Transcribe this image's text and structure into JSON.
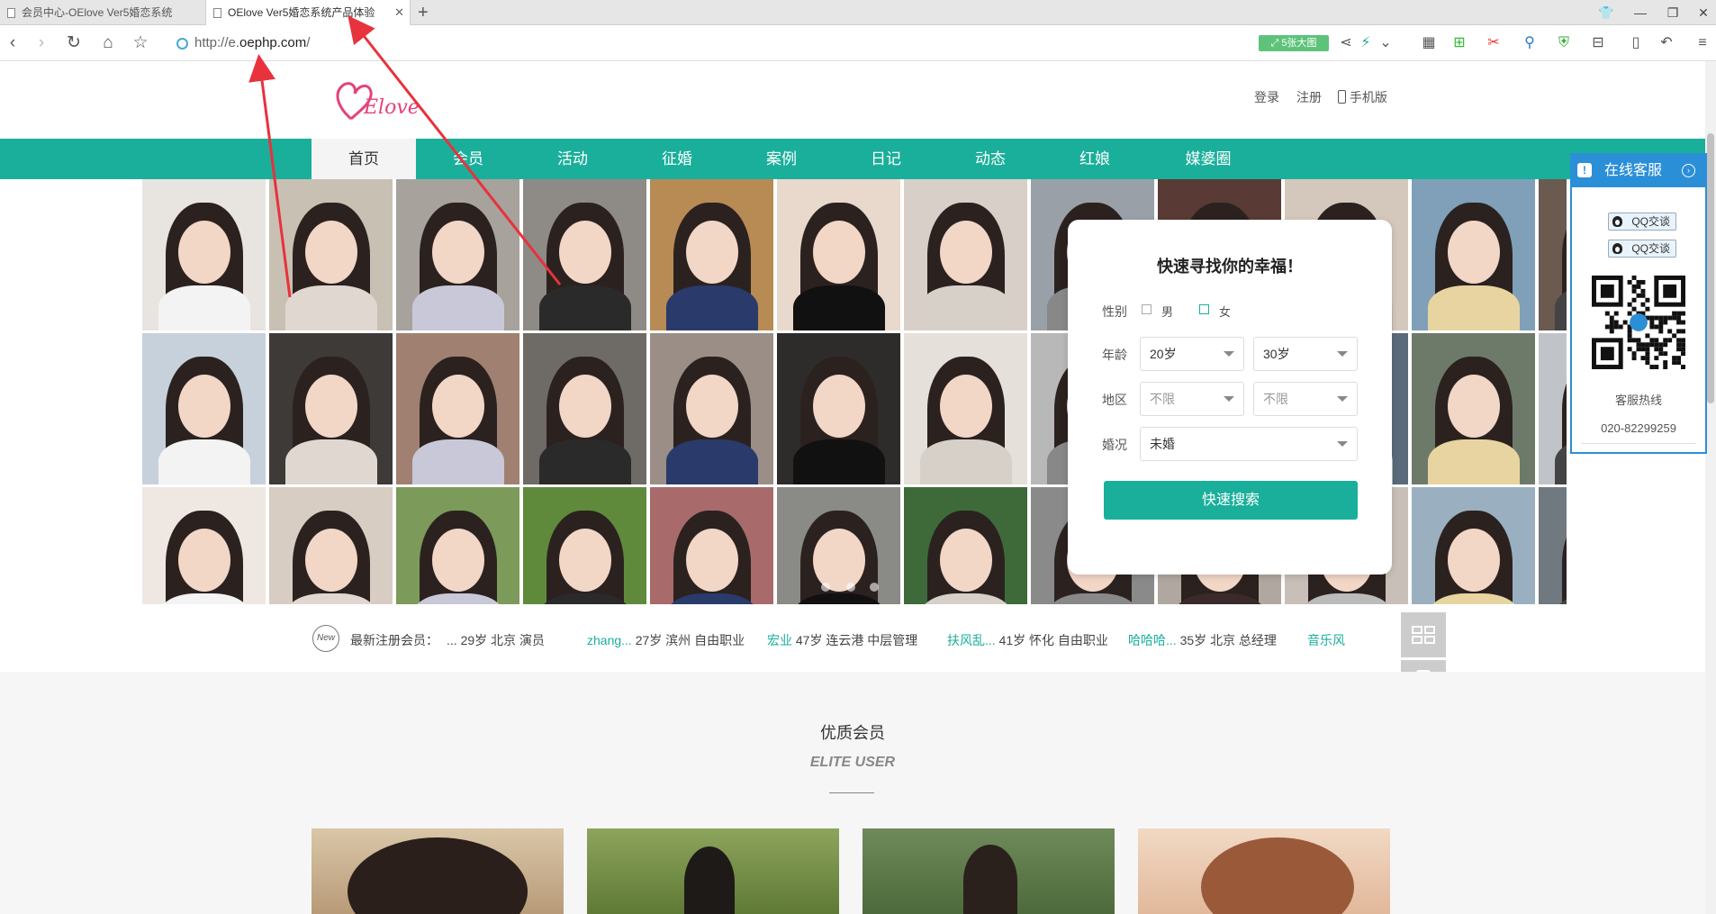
{
  "browser": {
    "tabs": [
      {
        "label": "会员中心-OElove Ver5婚恋系统"
      },
      {
        "label": "OElove Ver5婚恋系统产品体验"
      }
    ],
    "new_tab": "+",
    "url_prefix": "http://e.",
    "url_domain": "oephp.com",
    "url_suffix": "/",
    "pill_label": "5张大图"
  },
  "header": {
    "logo_text": "Elove",
    "login": "登录",
    "register": "注册",
    "mobile": "手机版"
  },
  "nav": {
    "items": [
      "首页",
      "会员",
      "活动",
      "征婚",
      "案例",
      "日记",
      "动态",
      "红娘",
      "媒婆圈"
    ],
    "active_index": 0
  },
  "search": {
    "title": "快速寻找你的幸福！",
    "gender_label": "性别",
    "male": "男",
    "female": "女",
    "age_label": "年龄",
    "age_from": "20岁",
    "age_to": "30岁",
    "region_label": "地区",
    "region_a": "不限",
    "region_b": "不限",
    "marital_label": "婚况",
    "marital_value": "未婚",
    "button": "快速搜索"
  },
  "service": {
    "title": "在线客服",
    "qq1": "QQ交谈",
    "qq2": "QQ交谈",
    "hotline_label": "客服热线",
    "hotline": "020-82299259"
  },
  "ticker": {
    "badge": "New",
    "label": "最新注册会员：",
    "entries": [
      {
        "name": "...",
        "info": "29岁 北京 演员"
      },
      {
        "name": "zhang...",
        "info": "27岁 滨州 自由职业"
      },
      {
        "name": "宏业",
        "info": "47岁 连云港 中层管理"
      },
      {
        "name": "扶风乱...",
        "info": "41岁 怀化 自由职业"
      },
      {
        "name": "哈哈哈...",
        "info": "35岁 北京 总经理"
      },
      {
        "name": "音乐风",
        "info": ""
      }
    ]
  },
  "elite": {
    "title": "优质会员",
    "subtitle": "ELITE USER"
  },
  "colors": {
    "brand": "#1aaf9a",
    "service_blue": "#2b8fd8",
    "annotation_red": "#e8323c"
  }
}
